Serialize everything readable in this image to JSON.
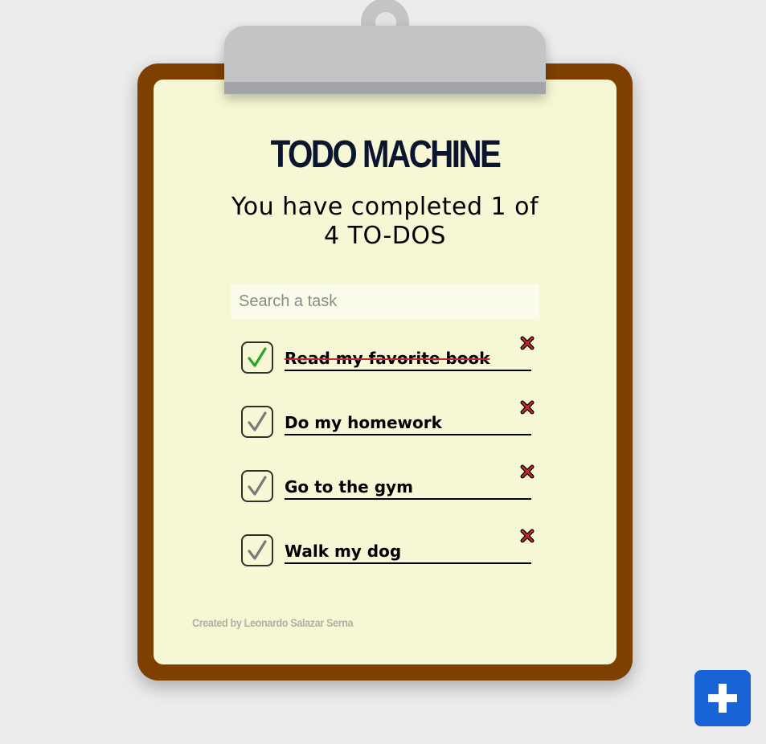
{
  "app": {
    "title": "TODO MACHINE",
    "counter_text": "You have completed 1 of 4 TO-DOS"
  },
  "search": {
    "placeholder": "Search a task",
    "value": ""
  },
  "todos": [
    {
      "text": "Read my favorite book",
      "completed": true
    },
    {
      "text": "Do my homework",
      "completed": false
    },
    {
      "text": "Go to the gym",
      "completed": false
    },
    {
      "text": "Walk my dog",
      "completed": false
    }
  ],
  "footer": {
    "credits": "Created by Leonardo Salazar Serna"
  },
  "icons": {
    "check": "check-icon",
    "delete": "close-icon",
    "add": "plus-icon"
  },
  "colors": {
    "background": "#ececec",
    "board": "#7e3f00",
    "paper": "#f6f7d4",
    "clip": "#c3c4c6",
    "title": "#0c1530",
    "check_done": "#2aa32a",
    "check_pending": "#7a7a7a",
    "delete": "#c0282b",
    "add_button": "#1863d6"
  }
}
